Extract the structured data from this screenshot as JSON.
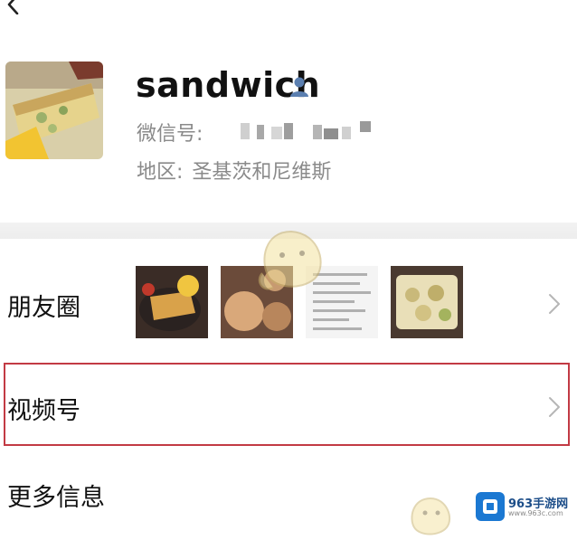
{
  "header": {
    "back_icon": "chevron-left-icon"
  },
  "profile": {
    "name": "sandwich",
    "wechat_id_label": "微信号:",
    "region_label": "地区:",
    "region_value": "圣基茨和尼维斯",
    "badge_icon": "person-icon"
  },
  "rows": {
    "moments_label": "朋友圈",
    "channels_label": "视频号",
    "more_info_label": "更多信息"
  },
  "brand": {
    "name": "963手游网",
    "site": "www.963c.com"
  },
  "colors": {
    "highlight": "#c23a44",
    "label_gray": "#8a8a8a",
    "brand_blue": "#1b78d2"
  }
}
